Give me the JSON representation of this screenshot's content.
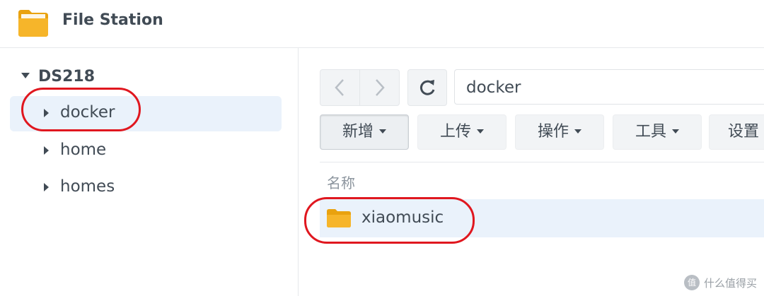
{
  "app": {
    "title": "File Station",
    "icon": "folder-app-icon"
  },
  "sidebar": {
    "root": {
      "label": "DS218",
      "expanded": true
    },
    "items": [
      {
        "label": "docker",
        "selected": true,
        "annotated": true
      },
      {
        "label": "home",
        "selected": false
      },
      {
        "label": "homes",
        "selected": false
      }
    ]
  },
  "toolbar": {
    "path": "docker",
    "buttons": [
      {
        "label": "新增",
        "dropdown": true,
        "active": true
      },
      {
        "label": "上传",
        "dropdown": true
      },
      {
        "label": "操作",
        "dropdown": true
      },
      {
        "label": "工具",
        "dropdown": true
      },
      {
        "label": "设置"
      }
    ]
  },
  "filelist": {
    "column_name": "名称",
    "rows": [
      {
        "name": "xiaomusic",
        "type": "folder",
        "selected": true,
        "annotated": true
      }
    ]
  },
  "watermark": {
    "text": "什么值得买",
    "badge": "值"
  },
  "colors": {
    "accent_select": "#eaf2fb",
    "annotation": "#e0171f",
    "folder": "#f5b724"
  }
}
